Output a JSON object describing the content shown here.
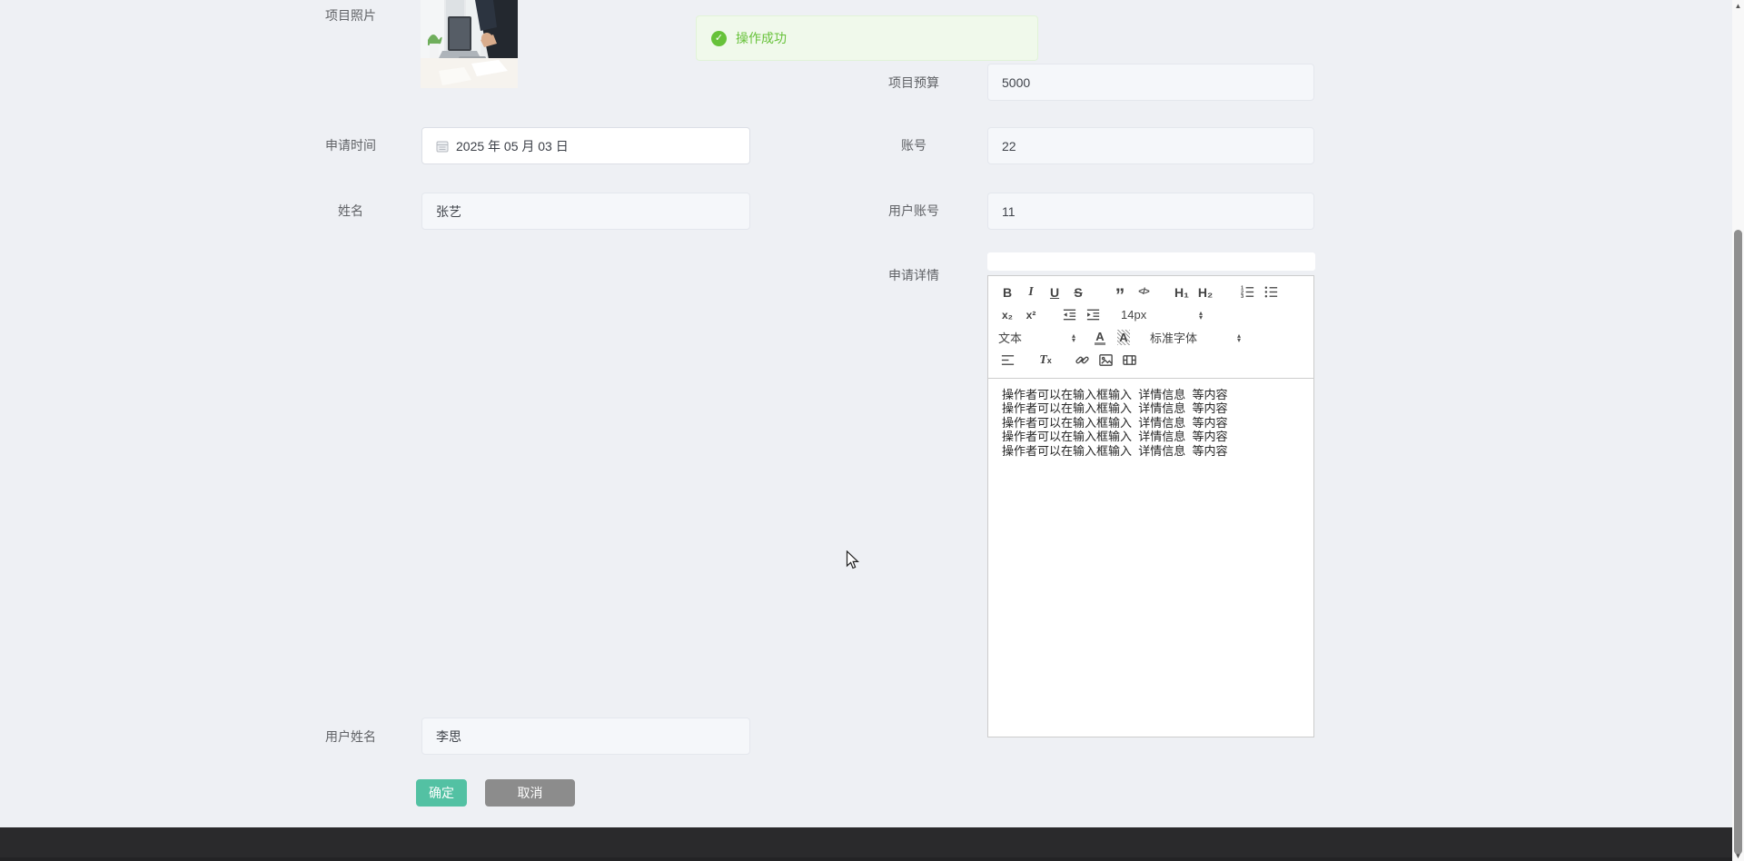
{
  "toast": {
    "text": "操作成功",
    "icon": "check-circle-icon",
    "color": "#67c23a",
    "bg": "#f0f9eb"
  },
  "labels": {
    "photo": "项目照片",
    "apply_time": "申请时间",
    "name": "姓名",
    "user_name": "用户姓名",
    "budget": "项目预算",
    "account": "账号",
    "user_account": "用户账号",
    "detail": "申请详情"
  },
  "values": {
    "apply_time": "2025 年 05 月 03 日",
    "name": "张艺",
    "user_name": "李思",
    "budget": "5000",
    "account": "22",
    "user_account": "11"
  },
  "editor": {
    "toolbar": {
      "bold": "B",
      "italic": "I",
      "underline": "U",
      "strike": "S",
      "quote": "”",
      "code": "</>",
      "h1": "H₁",
      "h2": "H₂",
      "subscript": "x₂",
      "superscript": "x²",
      "size": "14px",
      "header": "文本",
      "font": "标准字体",
      "color": "A",
      "background": "A",
      "clean_t": "T",
      "clean_x": "x"
    },
    "lines": [
      "操作者可以在输入框输入  详情信息  等内容",
      "操作者可以在输入框输入  详情信息  等内容",
      "操作者可以在输入框输入  详情信息  等内容",
      "操作者可以在输入框输入  详情信息  等内容",
      "操作者可以在输入框输入  详情信息  等内容"
    ]
  },
  "buttons": {
    "confirm": "确定",
    "cancel": "取消"
  },
  "colors": {
    "accent": "#53c1a3",
    "cancel_gray": "#8c8c8c",
    "success": "#67c23a",
    "footer": "#2a2a2c"
  }
}
